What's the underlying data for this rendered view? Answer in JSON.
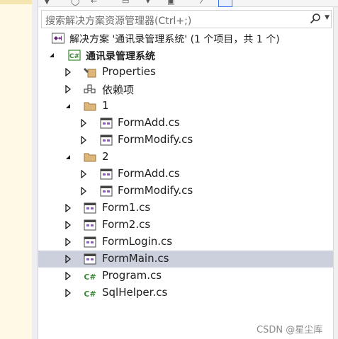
{
  "search": {
    "placeholder": "搜索解决方案资源管理器(Ctrl+;)"
  },
  "solution": {
    "label": "解决方案 '通讯录管理系统' (1 个项目，共 1 个)"
  },
  "project": {
    "label": "通讯录管理系统"
  },
  "tree": {
    "properties": "Properties",
    "dependencies": "依赖项",
    "folder1": "1",
    "f1_formadd": "FormAdd.cs",
    "f1_formmodify": "FormModify.cs",
    "folder2": "2",
    "f2_formadd": "FormAdd.cs",
    "f2_formmodify": "FormModify.cs",
    "form1": "Form1.cs",
    "form2": "Form2.cs",
    "formlogin": "FormLogin.cs",
    "formmain": "FormMain.cs",
    "program": "Program.cs",
    "sqlhelper": "SqlHelper.cs"
  },
  "watermark": "CSDN @星尘库",
  "colors": {
    "selected_row": "#ccd0dc",
    "csharp_green": "#388a34",
    "folder": "#dcb67a",
    "vs_purple": "#68217a"
  }
}
